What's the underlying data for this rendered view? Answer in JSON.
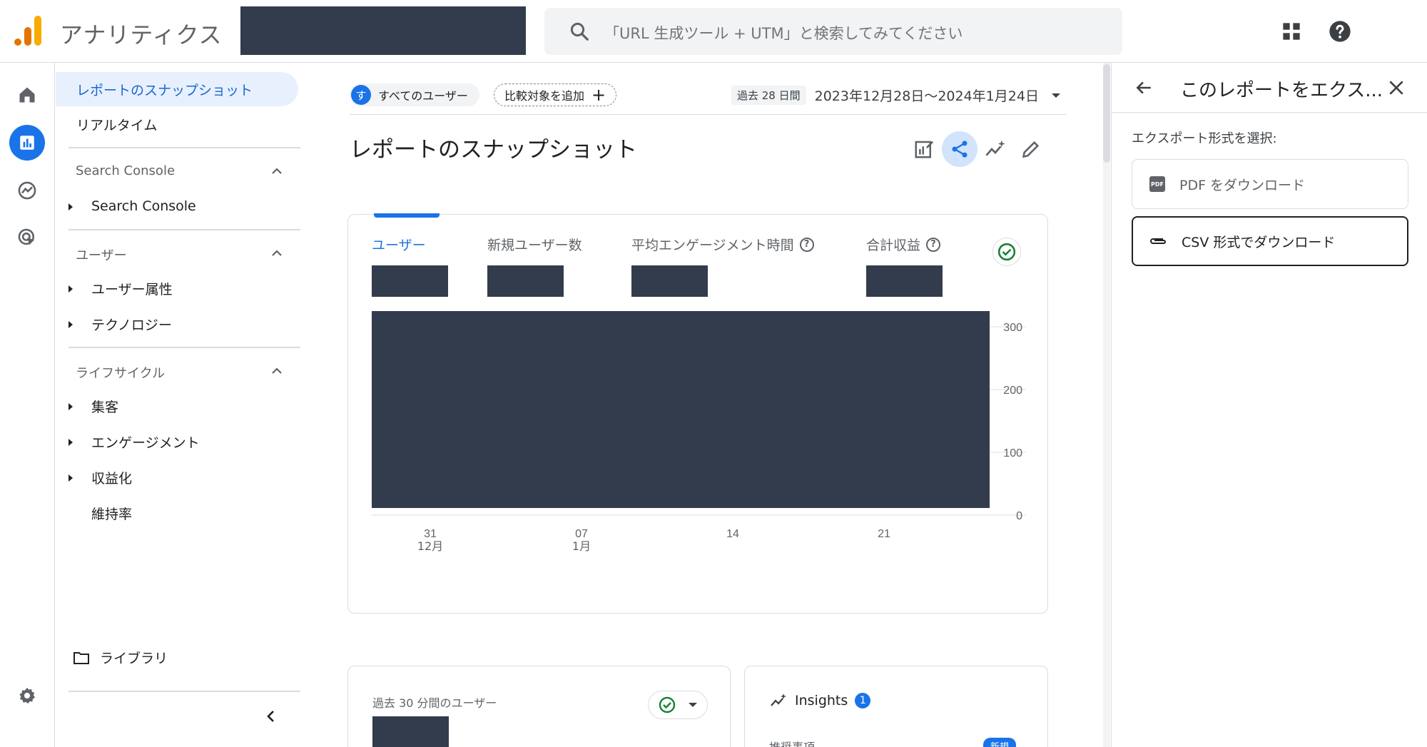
{
  "header": {
    "app_title": "アナリティクス",
    "search_placeholder": "「URL 生成ツール + UTM」と検索してみてください"
  },
  "nav": {
    "top_items": [
      {
        "label": "レポートのスナップショット",
        "selected": true
      },
      {
        "label": "リアルタイム",
        "selected": false
      }
    ],
    "groups": [
      {
        "title": "Search Console",
        "items": [
          "Search Console"
        ]
      },
      {
        "title": "ユーザー",
        "items": [
          "ユーザー属性",
          "テクノロジー"
        ]
      },
      {
        "title": "ライフサイクル",
        "items": [
          "集客",
          "エンゲージメント",
          "収益化",
          "維持率"
        ]
      }
    ],
    "library_label": "ライブラリ"
  },
  "filters": {
    "segment_initial": "す",
    "segment_label": "すべてのユーザー",
    "compare_label": "比較対象を追加",
    "compare_plus": "+",
    "date_badge": "過去 28 日間",
    "date_range": "2023年12月28日〜2024年1月24日"
  },
  "main": {
    "title": "レポートのスナップショット",
    "metrics": [
      {
        "label": "ユーザー",
        "selected": true,
        "help": false
      },
      {
        "label": "新規ユーザー数",
        "selected": false,
        "help": false
      },
      {
        "label": "平均エンゲージメント時間",
        "selected": false,
        "help": true
      },
      {
        "label": "合計収益",
        "selected": false,
        "help": true
      }
    ],
    "help_glyph": "?"
  },
  "chart_data": {
    "type": "line",
    "y_ticks": [
      "300",
      "200",
      "100",
      "0"
    ],
    "ylim": [
      0,
      300
    ],
    "x_ticks": [
      {
        "day": "31",
        "month": "12月"
      },
      {
        "day": "07",
        "month": "1月"
      },
      {
        "day": "14",
        "month": ""
      },
      {
        "day": "21",
        "month": ""
      }
    ]
  },
  "realtime": {
    "label": "過去 30 分間のユーザー"
  },
  "insights": {
    "title": "Insights",
    "count": "1",
    "row_label": "推奨事項",
    "new_badge": "新規"
  },
  "export_panel": {
    "title": "このレポートをエクス...",
    "subtitle": "エクスポート形式を選択:",
    "pdf_label": "PDF をダウンロード",
    "pdf_icon_text": "PDF",
    "csv_label": "CSV 形式でダウンロード"
  },
  "colors": {
    "accent": "#1a73e8",
    "redacted": "#333c4d",
    "logo_orange": "#e37400",
    "logo_yellow": "#f9ab00",
    "check_green": "#188038"
  }
}
